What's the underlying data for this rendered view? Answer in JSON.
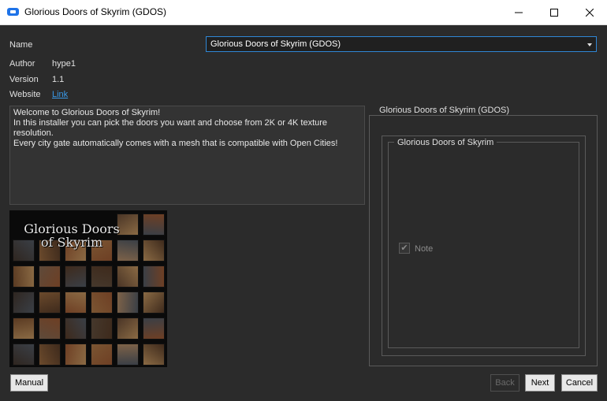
{
  "window": {
    "title": "Glorious Doors of Skyrim (GDOS)",
    "icon": "app-icon"
  },
  "fields": {
    "name_label": "Name",
    "name_value": "Glorious Doors of Skyrim (GDOS)",
    "author_label": "Author",
    "author_value": "hype1",
    "version_label": "Version",
    "version_value": "1.1",
    "website_label": "Website",
    "website_link": "Link"
  },
  "description": {
    "line1": "Welcome to Glorious Doors of Skyrim!",
    "line2": "In this installer you can pick the doors you want and choose from 2K or 4K texture resolution.",
    "line3": "Every city gate automatically comes with a mesh that is compatible with Open Cities!"
  },
  "preview": {
    "title_line1": "Glorious Doors",
    "title_line2": "of Skyrim"
  },
  "group": {
    "outer_title": "Glorious Doors of Skyrim (GDOS)",
    "inner_title": "Glorious Doors of Skyrim",
    "option_label": "Note",
    "option_checked": true
  },
  "buttons": {
    "manual": "Manual",
    "back": "Back",
    "next": "Next",
    "cancel": "Cancel"
  },
  "colors": {
    "background": "#2b2b2b",
    "accent": "#2f87d6",
    "link": "#3a9ae8"
  }
}
